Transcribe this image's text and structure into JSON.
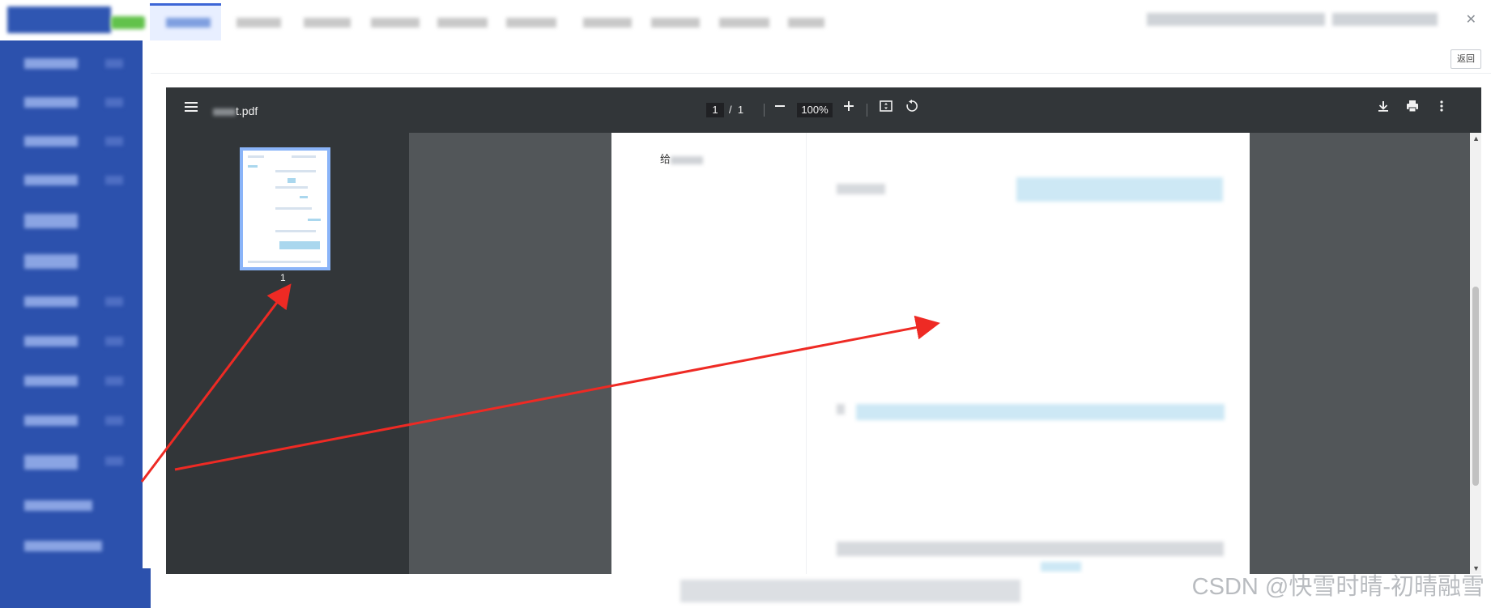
{
  "pdf_viewer": {
    "file_name_suffix": "t.pdf",
    "page_current": "1",
    "page_separator": "/",
    "page_total": "1",
    "zoom": "100%",
    "thumbnail_label": "1",
    "page_first_char": "给"
  },
  "header": {
    "back_button": "返回"
  },
  "watermark": "CSDN @快雪时晴-初晴融雪",
  "icons": {
    "menu": "menu-icon",
    "zoom_out": "minus-icon",
    "zoom_in": "plus-icon",
    "fit": "fit-page-icon",
    "rotate": "rotate-icon",
    "download": "download-icon",
    "print": "print-icon",
    "more": "more-vert-icon",
    "close": "close-icon"
  },
  "colors": {
    "sidebar": "#2c51ad",
    "viewer_toolbar": "#323639",
    "viewer_background": "#525659",
    "thumbnail_border": "#8ab4f8",
    "annotation_arrow": "#ee2a24"
  }
}
